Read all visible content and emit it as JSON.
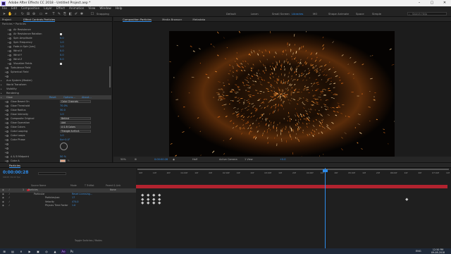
{
  "titlebar": {
    "title": "Adobe After Effects CC 2018 - Untitled Project.aep *"
  },
  "menu": [
    "File",
    "Edit",
    "Composition",
    "Layer",
    "Effect",
    "Animation",
    "View",
    "Window",
    "Help"
  ],
  "workspaces": [
    {
      "label": "Default",
      "active": false
    },
    {
      "label": "Learn",
      "active": false
    },
    {
      "label": "Small Screen",
      "active": false
    },
    {
      "label": "Libraries",
      "active": true
    },
    {
      "label": "MO",
      "active": false
    },
    {
      "label": "Shape Animate",
      "active": false
    },
    {
      "label": "Space",
      "active": false
    },
    {
      "label": "Simple",
      "active": false
    }
  ],
  "search_help": "Search Help",
  "snapping_label": "Snapping",
  "effect_controls": {
    "tab_project": "Project",
    "tab_label": "Effect Controls Particles",
    "subheader": "Particles • Particles",
    "rows": [
      {
        "label": "Air Resistance",
        "value": "",
        "indent": 8
      },
      {
        "label": "Air Resistance Rotation",
        "value": "",
        "indent": 8,
        "checkbox": true
      },
      {
        "label": "Spin Amplitude",
        "value": "0.0",
        "indent": 8
      },
      {
        "label": "Spin Frequency",
        "value": "1.0",
        "indent": 8
      },
      {
        "label": "Fade-in Spin [sec]",
        "value": "1.0",
        "indent": 8
      },
      {
        "label": "Wind X",
        "value": "0.0",
        "indent": 8
      },
      {
        "label": "Wind Y",
        "value": "0.0",
        "indent": 8
      },
      {
        "label": "Wind Z",
        "value": "0.0",
        "indent": 8
      },
      {
        "label": "Visualize Fields",
        "value": "",
        "indent": 8,
        "checkbox": true
      },
      {
        "label": "Turbulence Field",
        "value": "",
        "indent": 6
      },
      {
        "label": "Spherical Field",
        "value": "",
        "indent": 6
      },
      {
        "label": "",
        "value": "",
        "indent": 6
      },
      {
        "label": "Aux System (Master)",
        "value": "",
        "indent": 3
      },
      {
        "label": "World Transform",
        "value": "",
        "indent": 3
      },
      {
        "label": "Visibility",
        "value": "",
        "indent": 3
      },
      {
        "label": "Rendering",
        "value": "",
        "indent": 3
      },
      {
        "label": "Glow",
        "value": "",
        "indent": 3,
        "selected": true,
        "buttons": [
          "Reset",
          "Options...",
          "About..."
        ]
      },
      {
        "label": "Glow Based On",
        "value": "Color Channels",
        "indent": 6,
        "dropdown": true
      },
      {
        "label": "Glow Threshold",
        "value": "70.0%",
        "indent": 6
      },
      {
        "label": "Glow Radius",
        "value": "30.0",
        "indent": 6
      },
      {
        "label": "Glow Intensity",
        "value": "1.0",
        "indent": 6
      },
      {
        "label": "Composite Original",
        "value": "Behind",
        "indent": 6,
        "dropdown": true
      },
      {
        "label": "Glow Operation",
        "value": "Add",
        "indent": 6,
        "dropdown": true
      },
      {
        "label": "Glow Colors",
        "value": "A & B Colors",
        "indent": 6,
        "dropdown": true
      },
      {
        "label": "Color Looping",
        "value": "Triangle A>B>A",
        "indent": 6,
        "dropdown": true
      },
      {
        "label": "Color Loops",
        "value": "1.0",
        "indent": 6
      },
      {
        "label": "Color Phase",
        "value": "0x+0.0°",
        "indent": 6
      },
      {
        "label": "",
        "value": "",
        "indent": 6
      },
      {
        "label": "",
        "value": "",
        "indent": 6
      },
      {
        "label": "",
        "value": "",
        "indent": 6
      },
      {
        "label": "A & B Midpoint",
        "value": "50 %",
        "indent": 6
      },
      {
        "label": "Color A",
        "value": "",
        "indent": 6,
        "swatch": "#e8a27e"
      },
      {
        "label": "Color B",
        "value": "",
        "indent": 6,
        "swatch": "#d6453a"
      },
      {
        "label": "Glow Dimensions",
        "value": "Horizontal and Vertical",
        "indent": 6,
        "dropdown": true
      }
    ]
  },
  "comp_view": {
    "tabs": [
      "Composition Particles",
      "Media Browser",
      "Metadata"
    ],
    "comp_name": "Particles",
    "footer": {
      "zoom": "50%",
      "timecode": "0:00:00:28",
      "resolution": "Half",
      "camera": "Active Camera",
      "views": "1 View",
      "exposure": "+0.0"
    }
  },
  "timeline": {
    "tab_label": "Particles",
    "timecode": "0:00:00:28",
    "timecode_sub": "00028 (30.00 fps)",
    "col_headers": [
      "Source Name",
      "Mode",
      "T TrkMat",
      "Parent & Link"
    ],
    "layers": [
      {
        "num": "1",
        "name": "Particles",
        "mode": "",
        "parent": "None",
        "selected": true,
        "indent": 20
      },
      {
        "num": "",
        "name": "Particular",
        "mode": "",
        "parent": "",
        "indent": 24,
        "buttons": "Reset   Licensing..."
      },
      {
        "num": "",
        "name": "Particles/sec",
        "mode": "17",
        "parent": "",
        "indent": 32
      },
      {
        "num": "",
        "name": "Velocity",
        "mode": "474.0",
        "parent": "",
        "indent": 32
      },
      {
        "num": "",
        "name": "Physics Time Factor",
        "mode": "1.0",
        "parent": "",
        "indent": 32
      }
    ],
    "ruler": [
      "00f",
      "10f",
      "20f",
      "01:00f",
      "10f",
      "20f",
      "02:00f",
      "10f",
      "20f",
      "03:00f",
      "10f",
      "20f",
      "04:00f",
      "10f",
      "20f",
      "05:00f",
      "10f",
      "20f",
      "06:00f",
      "10f",
      "20f",
      "07:00f",
      "10f"
    ],
    "toggle_label": "Toggle Switches / Modes"
  },
  "taskbar": {
    "time": "12:50 PM",
    "date": "09-08-2018",
    "lang": "ENG"
  }
}
